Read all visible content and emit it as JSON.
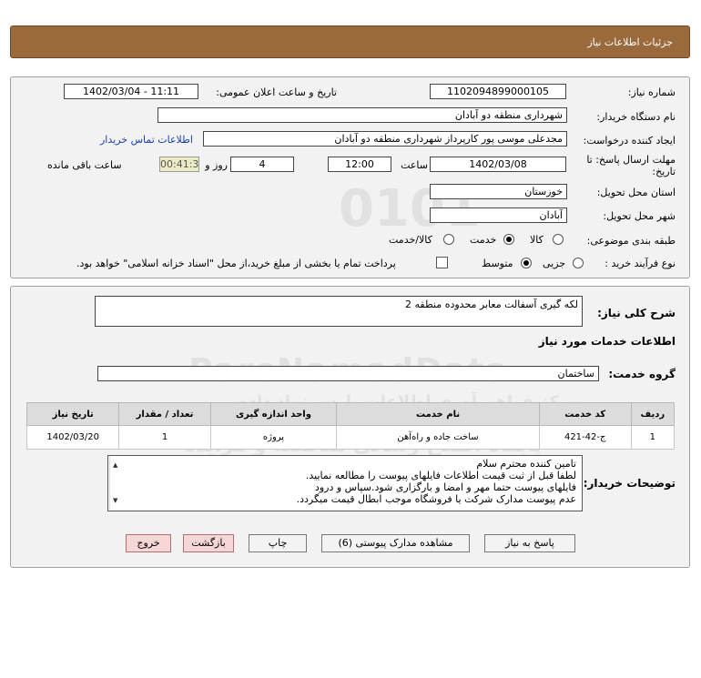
{
  "title": "جزئیات اطلاعات نیاز",
  "header": {
    "need_number_label": "شماره نیاز:",
    "need_number": "1102094899000105",
    "announce_label": "تاریخ و ساعت اعلان عمومی:",
    "announce_value": "1402/03/04 - 11:11",
    "buyer_org_label": "نام دستگاه خریدار:",
    "buyer_org": "شهرداری منطقه دو آبادان",
    "creator_label": "ایجاد کننده درخواست:",
    "creator": "مجدعلی موسی پور کارپرداز شهرداری منطقه دو آبادان",
    "contact_link": "اطلاعات تماس خریدار",
    "deadline_label_1": "مهلت ارسال پاسخ: تا",
    "deadline_label_2": "تاریخ:",
    "deadline_date": "1402/03/08",
    "time_label": "ساعت",
    "deadline_time": "12:00",
    "days_value": "4",
    "days_label": "روز و",
    "remaining_time": "00:41:31",
    "remaining_label": "ساعت باقی مانده",
    "province_label": "استان محل تحویل:",
    "province": "خوزستان",
    "city_label": "شهر محل تحویل:",
    "city": "آبادان",
    "category_label": "طبقه بندی موضوعی:",
    "category_options": [
      "کالا",
      "خدمت",
      "کالا/خدمت"
    ],
    "category_selected": "خدمت",
    "process_label": "نوع فرآیند خرید :",
    "process_options": [
      "جزیی",
      "متوسط"
    ],
    "process_selected": "متوسط",
    "payment_note": "پرداخت تمام یا بخشی از مبلغ خرید،از محل \"اسناد خزانه اسلامی\" خواهد بود."
  },
  "details": {
    "summary_label": "شرح کلی نیاز:",
    "summary": "لکه گیری آسفالت معابر محدوده منطقه 2",
    "services_heading": "اطلاعات خدمات مورد نیاز",
    "service_group_label": "گروه خدمت:",
    "service_group": "ساختمان",
    "table": {
      "headers": [
        "ردیف",
        "کد خدمت",
        "نام خدمت",
        "واحد اندازه گیری",
        "تعداد / مقدار",
        "تاریخ نیاز"
      ],
      "rows": [
        [
          "1",
          "ج-42-421",
          "ساخت جاده و راه‌آهن",
          "پروژه",
          "1",
          "1402/03/20"
        ]
      ]
    },
    "notes_label": "توضیحات خریدار:",
    "notes": [
      "تامین کننده محترم سلام",
      "لطفا قبل از ثبت قیمت اطلاعات فایلهای پیوست را مطالعه نمایید.",
      "فایلهای پیوست حتما مهر و امضا و بارگزاری شود.سپاس و درود",
      "عدم پیوست مدارک شرکت یا فروشگاه موجب ابطال قیمت میگردد."
    ]
  },
  "buttons": {
    "reply": "پاسخ به نیاز",
    "attachments": "مشاهده مدارک پیوستی (6)",
    "print": "چاپ",
    "back": "بازگشت",
    "exit": "خروج"
  },
  "watermark": {
    "main": "ParsNamadData",
    "line1": "مرکز فراهم آوری اطلاعات پارس نماد داده",
    "line2": "پایگاه اطلاع رسانی مناقصه و مزایده",
    "phone": "۰۲۱-۸۸۳۴۹۶۷۰"
  },
  "colors": {
    "titlebar": "#9a6a3c",
    "panel": "#f2f2f2",
    "timer_bg": "#ecebc5",
    "exit_bg": "#f7d6d6"
  }
}
